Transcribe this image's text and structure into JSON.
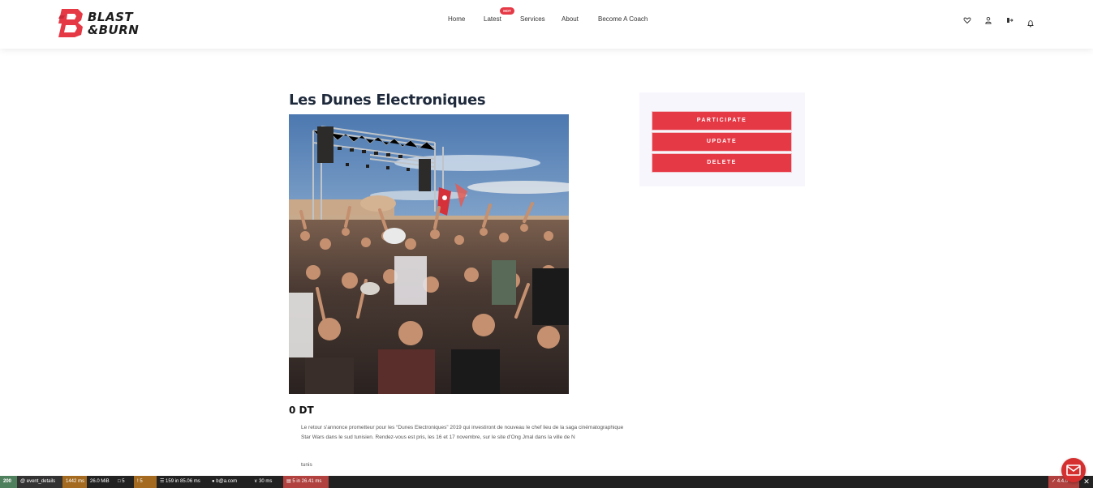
{
  "brand": {
    "line1": "BLAST",
    "line2": "&BURN",
    "accent": "#e63946"
  },
  "nav": {
    "home": "Home",
    "latest": "Latest",
    "hot_badge": "HOT",
    "services": "Services",
    "about": "About",
    "coach": "Become A Coach"
  },
  "header_icons": [
    "heart-icon",
    "user-icon",
    "logout-icon",
    "bell-icon"
  ],
  "event": {
    "title": "Les Dunes Electroniques",
    "price": "0 DT",
    "description": "Le retour s'annonce prometteur pour les “Dunes Electroniques” 2019 qui investiront de nouveau le chef lieu de la saga cinématographique Star Wars dans le sud tunisien. Rendez-vous est pris, les 16 et 17 novembre, sur le site d'Ong Jmal dans la ville de N",
    "location": "tunis"
  },
  "actions": {
    "participate": "PARTICIPATE",
    "update": "UPDATE",
    "delete": "DELETE"
  },
  "debugbar": {
    "status": "200",
    "route": "@ event_details",
    "time": "1442 ms",
    "memory": "26.0 MiB",
    "forms": "5",
    "logs": "5",
    "cache": "159 in 85.06 ms",
    "user": "b@a.com",
    "twig": "30 ms",
    "db": "5 in 26.41 ms",
    "version": "4.4.0"
  }
}
